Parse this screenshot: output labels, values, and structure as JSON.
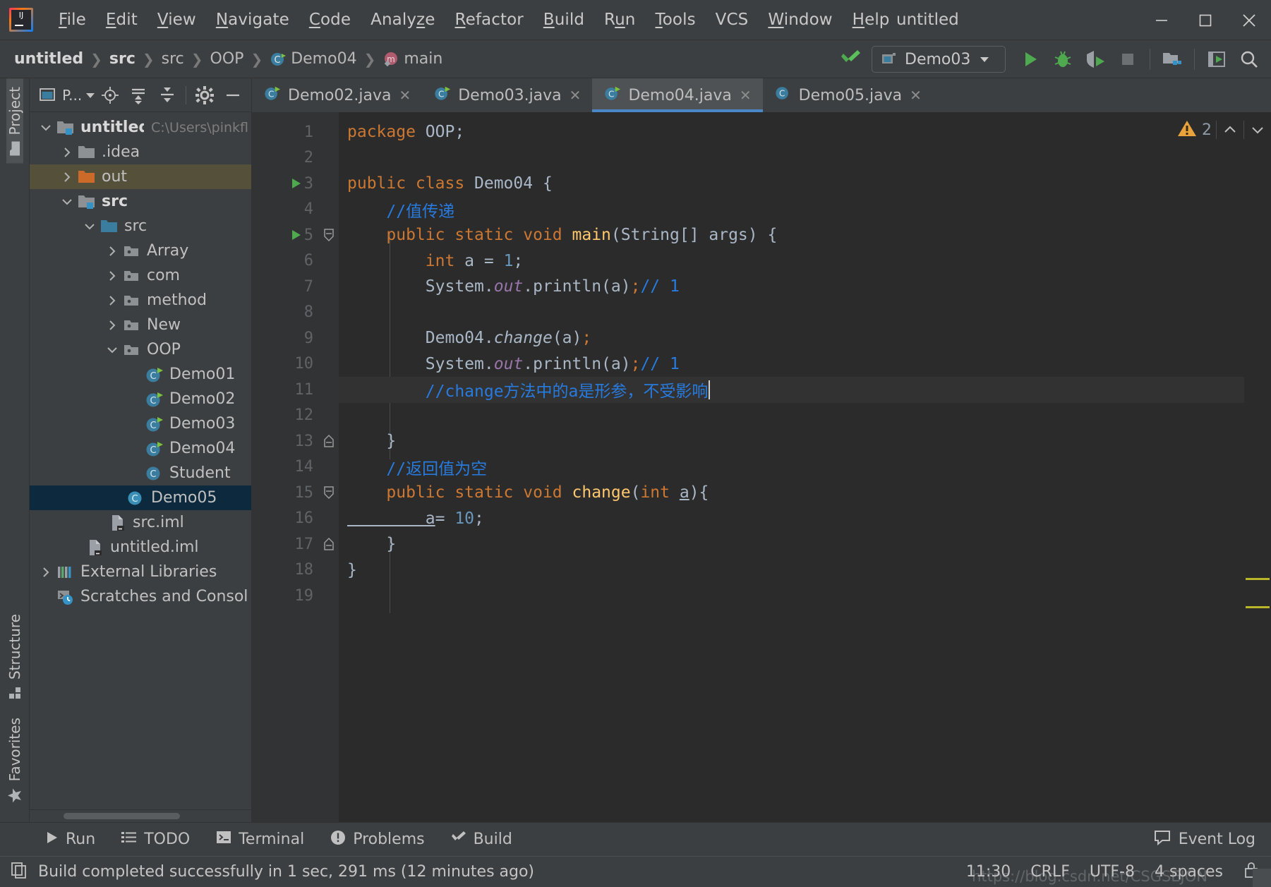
{
  "window": {
    "title": "untitled",
    "logo_text": "IJ",
    "controls": [
      "minimize",
      "maximize",
      "close"
    ]
  },
  "menu": [
    {
      "label": "File",
      "mnemonic": "F"
    },
    {
      "label": "Edit",
      "mnemonic": "E"
    },
    {
      "label": "View",
      "mnemonic": "V"
    },
    {
      "label": "Navigate",
      "mnemonic": "N"
    },
    {
      "label": "Code",
      "mnemonic": "C"
    },
    {
      "label": "Analyze",
      "mnemonic": "z"
    },
    {
      "label": "Refactor",
      "mnemonic": "R"
    },
    {
      "label": "Build",
      "mnemonic": "B"
    },
    {
      "label": "Run",
      "mnemonic": "u"
    },
    {
      "label": "Tools",
      "mnemonic": "T"
    },
    {
      "label": "VCS",
      "mnemonic": ""
    },
    {
      "label": "Window",
      "mnemonic": "W"
    },
    {
      "label": "Help",
      "mnemonic": "H"
    }
  ],
  "breadcrumb": [
    {
      "label": "untitled",
      "icon": "",
      "bold": true
    },
    {
      "label": "src",
      "icon": "",
      "bold": true
    },
    {
      "label": "src",
      "icon": "",
      "bold": false
    },
    {
      "label": "OOP",
      "icon": "",
      "bold": false
    },
    {
      "label": "Demo04",
      "icon": "class-icon",
      "bold": false
    },
    {
      "label": "main",
      "icon": "method-icon",
      "bold": false
    }
  ],
  "toolbar": {
    "build_icon": "hammer-icon",
    "run_config": "Demo03",
    "buttons": [
      {
        "name": "run-button",
        "icon": "play-icon"
      },
      {
        "name": "debug-button",
        "icon": "bug-icon"
      },
      {
        "name": "run-with-coverage-button",
        "icon": "coverage-icon"
      },
      {
        "name": "stop-button",
        "icon": "stop-icon"
      },
      {
        "name": "project-structure-button",
        "icon": "project-structure-icon"
      },
      {
        "name": "update-button",
        "icon": "update-icon"
      },
      {
        "name": "search-everywhere-button",
        "icon": "search-icon"
      }
    ]
  },
  "left_stripe": {
    "top": [
      {
        "label": "Project",
        "icon": "folder-icon",
        "active": true
      }
    ],
    "bottom": [
      {
        "label": "Structure",
        "icon": "structure-icon",
        "active": false
      },
      {
        "label": "Favorites",
        "icon": "star-icon",
        "active": false
      }
    ]
  },
  "project_panel": {
    "title": "P...",
    "toolbar_icons": [
      "window-icon",
      "locate-icon",
      "expand-all-icon",
      "collapse-all-icon",
      "gear-icon",
      "hide-icon"
    ],
    "tree": [
      {
        "label": "untitled",
        "path": "C:\\Users\\pinkfl",
        "indent": 0,
        "arrow": "down",
        "icon": "module-folder-icon",
        "bold": true,
        "selected": null
      },
      {
        "label": ".idea",
        "path": "",
        "indent": 1,
        "arrow": "right",
        "icon": "folder-icon",
        "bold": false,
        "selected": null
      },
      {
        "label": "out",
        "path": "",
        "indent": 1,
        "arrow": "right",
        "icon": "folder-orange-icon",
        "bold": false,
        "selected": "olive"
      },
      {
        "label": "src",
        "path": "",
        "indent": 1,
        "arrow": "down",
        "icon": "module-folder-icon",
        "bold": true,
        "selected": null
      },
      {
        "label": "src",
        "path": "",
        "indent": 2,
        "arrow": "down",
        "icon": "source-folder-icon",
        "bold": false,
        "selected": null
      },
      {
        "label": "Array",
        "path": "",
        "indent": 3,
        "arrow": "right",
        "icon": "package-icon",
        "bold": false,
        "selected": null
      },
      {
        "label": "com",
        "path": "",
        "indent": 3,
        "arrow": "right",
        "icon": "package-icon",
        "bold": false,
        "selected": null
      },
      {
        "label": "method",
        "path": "",
        "indent": 3,
        "arrow": "right",
        "icon": "package-icon",
        "bold": false,
        "selected": null
      },
      {
        "label": "New",
        "path": "",
        "indent": 3,
        "arrow": "right",
        "icon": "package-icon",
        "bold": false,
        "selected": null
      },
      {
        "label": "OOP",
        "path": "",
        "indent": 3,
        "arrow": "down",
        "icon": "package-icon",
        "bold": false,
        "selected": null
      },
      {
        "label": "Demo01",
        "path": "",
        "indent": 4,
        "arrow": "",
        "icon": "java-class-runnable-icon",
        "bold": false,
        "selected": null
      },
      {
        "label": "Demo02",
        "path": "",
        "indent": 4,
        "arrow": "",
        "icon": "java-class-runnable-icon",
        "bold": false,
        "selected": null
      },
      {
        "label": "Demo03",
        "path": "",
        "indent": 4,
        "arrow": "",
        "icon": "java-class-runnable-icon",
        "bold": false,
        "selected": null
      },
      {
        "label": "Demo04",
        "path": "",
        "indent": 4,
        "arrow": "",
        "icon": "java-class-runnable-icon",
        "bold": false,
        "selected": null
      },
      {
        "label": "Student",
        "path": "",
        "indent": 4,
        "arrow": "",
        "icon": "java-class-icon",
        "bold": false,
        "selected": null
      },
      {
        "label": "Demo05",
        "path": "",
        "indent": 3,
        "arrow": "",
        "icon": "java-class-icon",
        "bold": false,
        "selected": "blue"
      },
      {
        "label": "src.iml",
        "path": "",
        "indent": 2,
        "arrow": "",
        "icon": "iml-file-icon",
        "bold": false,
        "selected": null
      },
      {
        "label": "untitled.iml",
        "path": "",
        "indent": 1,
        "arrow": "",
        "icon": "iml-file-icon",
        "bold": false,
        "selected": null
      },
      {
        "label": "External Libraries",
        "path": "",
        "indent": 0,
        "arrow": "right",
        "icon": "libraries-icon",
        "bold": false,
        "selected": null
      },
      {
        "label": "Scratches and Consoles",
        "path": "",
        "indent": 0,
        "arrow": "",
        "icon": "scratches-icon",
        "bold": false,
        "selected": null
      }
    ]
  },
  "editor_tabs": [
    {
      "label": "Demo02.java",
      "icon": "java-class-runnable-icon",
      "active": false
    },
    {
      "label": "Demo03.java",
      "icon": "java-class-runnable-icon",
      "active": false
    },
    {
      "label": "Demo04.java",
      "icon": "java-class-runnable-icon",
      "active": true
    },
    {
      "label": "Demo05.java",
      "icon": "java-class-icon",
      "active": false
    }
  ],
  "editor": {
    "warning_count": "2",
    "caret_line": 11,
    "lines": [
      {
        "n": "1",
        "runnable": false,
        "fold": "",
        "caret": false,
        "tokens": [
          {
            "t": "package ",
            "c": "kw"
          },
          {
            "t": "OOP",
            "c": "plain"
          },
          {
            "t": ";",
            "c": "plain"
          }
        ]
      },
      {
        "n": "2",
        "runnable": false,
        "fold": "",
        "caret": false,
        "tokens": []
      },
      {
        "n": "3",
        "runnable": true,
        "fold": "",
        "caret": false,
        "tokens": [
          {
            "t": "public class ",
            "c": "kw"
          },
          {
            "t": "Demo04 ",
            "c": "plain"
          },
          {
            "t": "{",
            "c": "plain"
          }
        ]
      },
      {
        "n": "4",
        "runnable": false,
        "fold": "",
        "caret": false,
        "tokens": [
          {
            "t": "    //值传递",
            "c": "cmt-blue"
          }
        ]
      },
      {
        "n": "5",
        "runnable": true,
        "fold": "start",
        "caret": false,
        "tokens": [
          {
            "t": "    public static void ",
            "c": "kw"
          },
          {
            "t": "main",
            "c": "mth"
          },
          {
            "t": "(",
            "c": "plain"
          },
          {
            "t": "String",
            "c": "plain"
          },
          {
            "t": "[] args) {",
            "c": "plain"
          }
        ]
      },
      {
        "n": "6",
        "runnable": false,
        "fold": "",
        "caret": false,
        "tokens": [
          {
            "t": "        int ",
            "c": "kw"
          },
          {
            "t": "a = ",
            "c": "plain"
          },
          {
            "t": "1",
            "c": "num2"
          },
          {
            "t": ";",
            "c": "plain"
          }
        ]
      },
      {
        "n": "7",
        "runnable": false,
        "fold": "",
        "caret": false,
        "tokens": [
          {
            "t": "        System.",
            "c": "plain"
          },
          {
            "t": "out",
            "c": "fld"
          },
          {
            "t": ".println(a)",
            "c": "plain"
          },
          {
            "t": ";",
            "c": "kw"
          },
          {
            "t": "// 1",
            "c": "cmt-blue"
          }
        ]
      },
      {
        "n": "8",
        "runnable": false,
        "fold": "",
        "caret": false,
        "tokens": []
      },
      {
        "n": "9",
        "runnable": false,
        "fold": "",
        "caret": false,
        "tokens": [
          {
            "t": "        Demo04.",
            "c": "plain"
          },
          {
            "t": "change",
            "c": "plain-ital"
          },
          {
            "t": "(a)",
            "c": "plain"
          },
          {
            "t": ";",
            "c": "kw"
          }
        ]
      },
      {
        "n": "10",
        "runnable": false,
        "fold": "",
        "caret": false,
        "tokens": [
          {
            "t": "        System.",
            "c": "plain"
          },
          {
            "t": "out",
            "c": "fld"
          },
          {
            "t": ".println(a)",
            "c": "plain"
          },
          {
            "t": ";",
            "c": "kw"
          },
          {
            "t": "// 1",
            "c": "cmt-blue"
          }
        ]
      },
      {
        "n": "11",
        "runnable": false,
        "fold": "",
        "caret": true,
        "tokens": [
          {
            "t": "        //change方法中的a是形参，不受影响",
            "c": "cmt-blue"
          }
        ]
      },
      {
        "n": "12",
        "runnable": false,
        "fold": "",
        "caret": false,
        "tokens": []
      },
      {
        "n": "13",
        "runnable": false,
        "fold": "end",
        "caret": false,
        "tokens": [
          {
            "t": "    }",
            "c": "plain"
          }
        ]
      },
      {
        "n": "14",
        "runnable": false,
        "fold": "",
        "caret": false,
        "tokens": [
          {
            "t": "    //返回值为空",
            "c": "cmt-blue"
          }
        ]
      },
      {
        "n": "15",
        "runnable": false,
        "fold": "start",
        "caret": false,
        "tokens": [
          {
            "t": "    public static void ",
            "c": "kw"
          },
          {
            "t": "change",
            "c": "mth"
          },
          {
            "t": "(",
            "c": "plain"
          },
          {
            "t": "int ",
            "c": "kw"
          },
          {
            "t": "a",
            "c": "plain-underline"
          },
          {
            "t": "){",
            "c": "plain"
          }
        ]
      },
      {
        "n": "16",
        "runnable": false,
        "fold": "",
        "caret": false,
        "tokens": [
          {
            "t": "        a",
            "c": "plain-underline"
          },
          {
            "t": "= ",
            "c": "plain"
          },
          {
            "t": "10",
            "c": "num2"
          },
          {
            "t": ";",
            "c": "plain"
          }
        ]
      },
      {
        "n": "17",
        "runnable": false,
        "fold": "end",
        "caret": false,
        "tokens": [
          {
            "t": "    }",
            "c": "plain"
          }
        ]
      },
      {
        "n": "18",
        "runnable": false,
        "fold": "",
        "caret": false,
        "tokens": [
          {
            "t": "}",
            "c": "plain"
          }
        ]
      },
      {
        "n": "19",
        "runnable": false,
        "fold": "",
        "caret": false,
        "tokens": []
      }
    ]
  },
  "bottom_bar": {
    "items": [
      {
        "label": "Run",
        "icon": "play-icon"
      },
      {
        "label": "TODO",
        "icon": "list-icon"
      },
      {
        "label": "Terminal",
        "icon": "terminal-icon"
      },
      {
        "label": "Problems",
        "icon": "problems-icon"
      },
      {
        "label": "Build",
        "icon": "hammer-icon"
      }
    ],
    "right": {
      "label": "Event Log",
      "icon": "event-log-icon"
    }
  },
  "status_bar": {
    "message": "Build completed successfully in 1 sec, 291 ms (12 minutes ago)",
    "message_icon": "copy-icon",
    "time": "11:30",
    "line_separator": "CRLF",
    "encoding": "UTF-8",
    "indent": "4 spaces",
    "lock_icon": "lock-icon",
    "watermark": "https://blog.csdn.net/CSGSEJON"
  },
  "colors": {
    "accent": "#4a88c7",
    "keyword": "#cc7832",
    "comment_blue": "#287bde",
    "number": "#6897bb",
    "method": "#ffc66d",
    "field": "#9876aa",
    "text": "#a9b7c6",
    "selection_blue": "#0d293e",
    "selection_olive": "#55503a",
    "warning": "#e8a33d"
  }
}
